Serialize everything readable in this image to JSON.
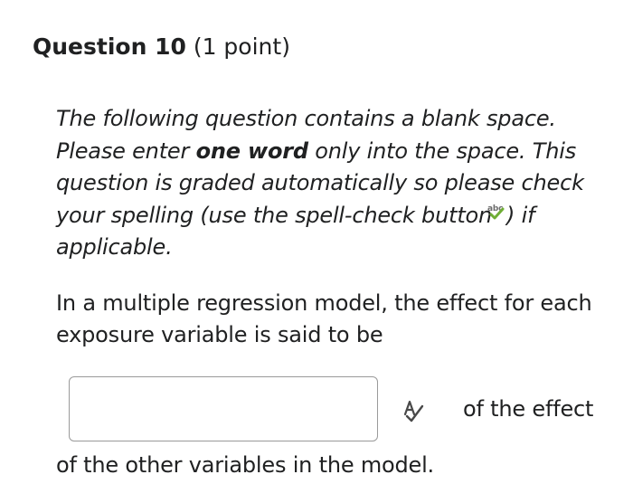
{
  "question": {
    "title": "Question 10",
    "points": "(1 point)"
  },
  "instructions": {
    "part1": "The following question contains a blank space. Please enter ",
    "bold": "one word",
    "part2": " only into the space. This question is graded automatically so please check your spelling (use the spell-check button",
    "icon_text": "abc",
    "part3": ") if applicable."
  },
  "prompt": {
    "text": "In a multiple regression model, the effect for each exposure variable is said to be",
    "after_blank": "of the effect",
    "continuation": "of the other variables in the model."
  },
  "answer": {
    "value": "",
    "placeholder": ""
  },
  "icons": {
    "inline_spellcheck": "spellcheck-abc-icon",
    "spell_button": "spellcheck-icon"
  },
  "colors": {
    "text": "#202122",
    "input_border": "#9a9a9a",
    "check_green": "#6fae35"
  }
}
